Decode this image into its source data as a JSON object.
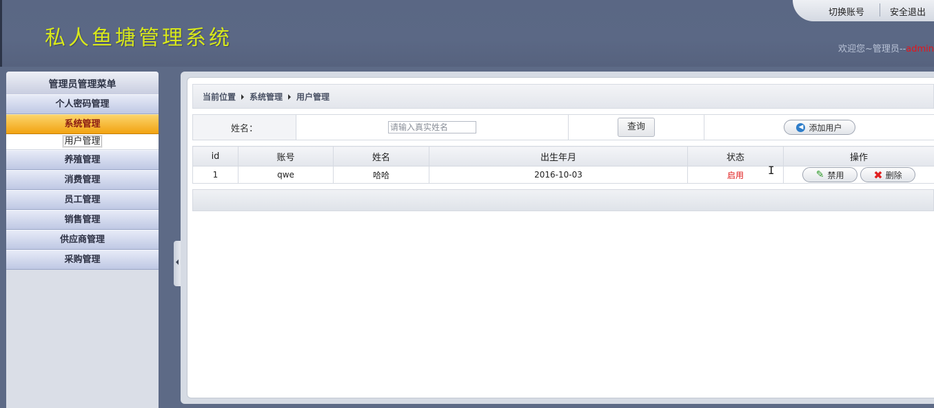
{
  "header": {
    "logo_text": "私人鱼塘管理系统",
    "switch_account": "切换账号",
    "logout": "安全退出",
    "welcome": "欢迎您~管理员--",
    "username": "admin"
  },
  "sidebar": {
    "title": "管理员管理菜单",
    "items": [
      {
        "label": "个人密码管理"
      },
      {
        "label": "系统管理",
        "active": true
      },
      {
        "label": "用户管理",
        "sub": true
      },
      {
        "label": "养殖管理"
      },
      {
        "label": "消费管理"
      },
      {
        "label": "员工管理"
      },
      {
        "label": "销售管理"
      },
      {
        "label": "供应商管理"
      },
      {
        "label": "采购管理"
      }
    ]
  },
  "breadcrumb": {
    "items": [
      "当前位置",
      "系统管理",
      "用户管理"
    ]
  },
  "search": {
    "label": "姓名：",
    "placeholder": "请输入真实姓名",
    "query_button": "查询",
    "add_button": "添加用户"
  },
  "table": {
    "headers": [
      "id",
      "账号",
      "姓名",
      "出生年月",
      "状态",
      "操作"
    ],
    "rows": [
      {
        "id": "1",
        "account": "qwe",
        "name": "哈哈",
        "birth": "2016-10-03",
        "status": "启用",
        "disable_label": "禁用",
        "delete_label": "删除"
      }
    ]
  },
  "colors": {
    "header_bg": "#5b6885",
    "logo": "#d8e81c",
    "active_menu": "#f2a311",
    "status_text": "#e01a1a"
  }
}
